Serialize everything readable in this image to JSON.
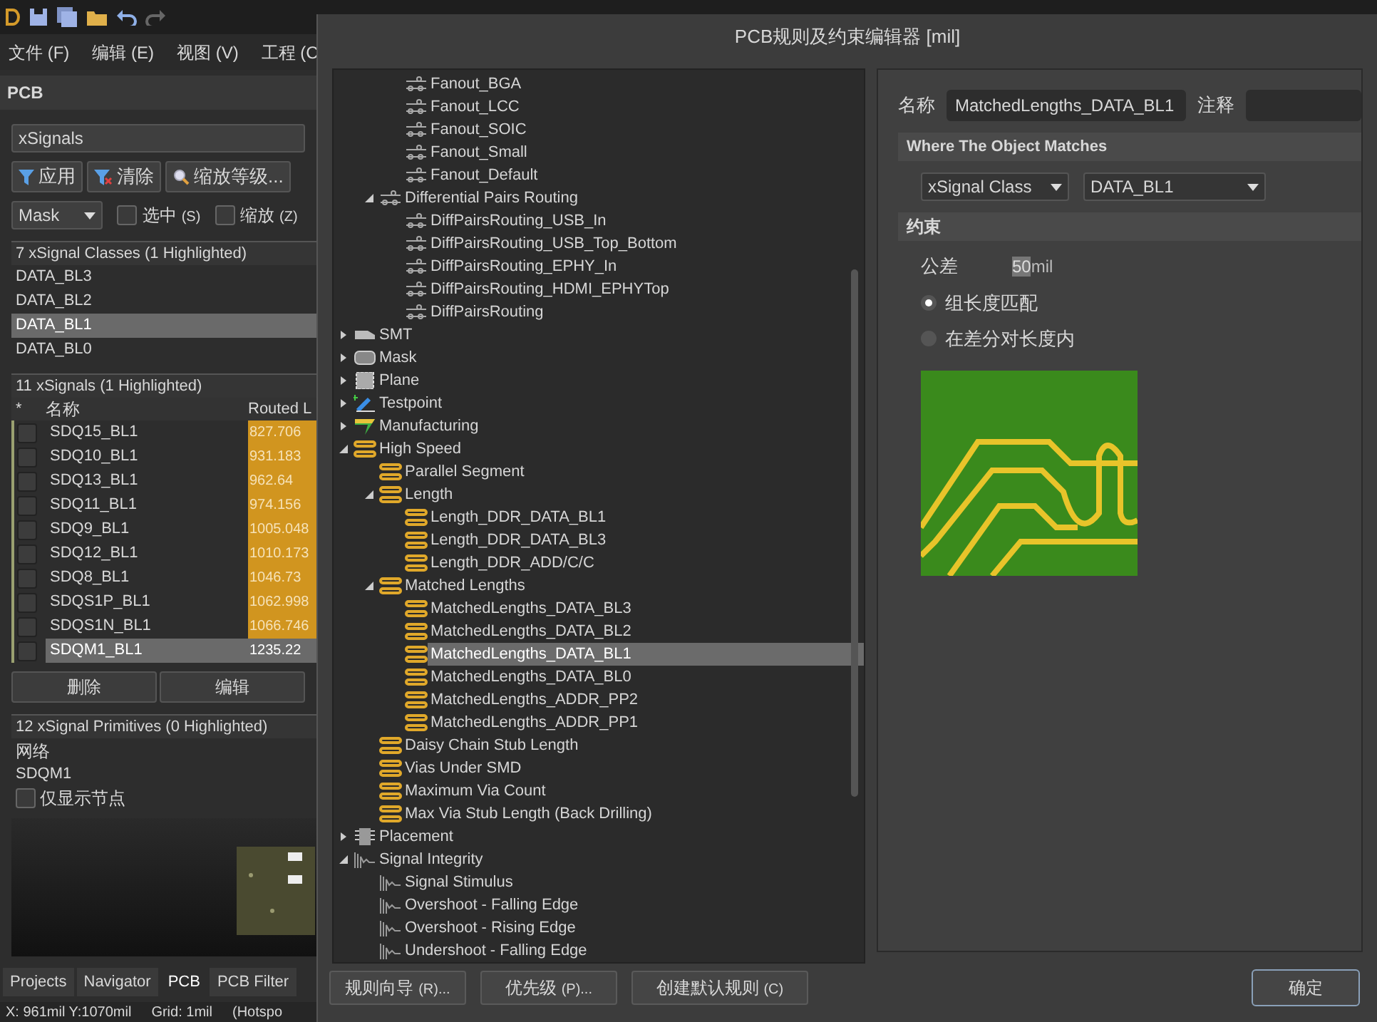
{
  "menu": [
    "文件 (F)",
    "编辑 (E)",
    "视图 (V)",
    "工程 (C"
  ],
  "panel": {
    "title": "PCB",
    "filter_select": "xSignals",
    "filter_buttons": [
      {
        "kind": "filter",
        "label": "应用"
      },
      {
        "kind": "clear",
        "label": "清除"
      },
      {
        "kind": "zoom",
        "label": "缩放等级..."
      }
    ],
    "mask_select": "Mask",
    "options": [
      {
        "label": "选中",
        "hotkey": "(S)",
        "checked": false
      },
      {
        "label": "缩放",
        "hotkey": "(Z)",
        "checked": false
      }
    ],
    "classes": {
      "header": "7 xSignal Classes (1 Highlighted)",
      "rows": [
        {
          "name": "DATA_BL3",
          "selected": false
        },
        {
          "name": "DATA_BL2",
          "selected": false
        },
        {
          "name": "DATA_BL1",
          "selected": true
        },
        {
          "name": "DATA_BL0",
          "selected": false
        }
      ]
    },
    "signals": {
      "header": "11 xSignals (1 Highlighted)",
      "columns": [
        "*",
        "名称",
        "Routed L"
      ],
      "rows": [
        {
          "name": "SDQ15_BL1",
          "routed": "827.706",
          "selected": false
        },
        {
          "name": "SDQ10_BL1",
          "routed": "931.183",
          "selected": false
        },
        {
          "name": "SDQ13_BL1",
          "routed": "962.64",
          "selected": false
        },
        {
          "name": "SDQ11_BL1",
          "routed": "974.156",
          "selected": false
        },
        {
          "name": "SDQ9_BL1",
          "routed": "1005.048",
          "selected": false
        },
        {
          "name": "SDQ12_BL1",
          "routed": "1010.173",
          "selected": false
        },
        {
          "name": "SDQ8_BL1",
          "routed": "1046.73",
          "selected": false
        },
        {
          "name": "SDQS1P_BL1",
          "routed": "1062.998",
          "selected": false
        },
        {
          "name": "SDQS1N_BL1",
          "routed": "1066.746",
          "selected": false
        },
        {
          "name": "SDQM1_BL1",
          "routed": "1235.22",
          "selected": true
        }
      ]
    },
    "actions": [
      "删除",
      "编辑"
    ],
    "primitives": {
      "header": "12 xSignal Primitives (0 Highlighted)",
      "column": "网络",
      "row": "SDQM1"
    },
    "nodes_only": {
      "label": "仅显示节点",
      "checked": false
    },
    "tabs": [
      {
        "label": "Projects",
        "selected": false
      },
      {
        "label": "Navigator",
        "selected": false
      },
      {
        "label": "PCB",
        "selected": true
      },
      {
        "label": "PCB Filter",
        "selected": false
      }
    ],
    "status_bar": [
      "X: 961mil Y:1070mil",
      "Grid: 1mil",
      "(Hotspo"
    ]
  },
  "dialog": {
    "title": "PCB规则及约束编辑器 [mil]",
    "tree": [
      {
        "children": [
          {
            "children": [
              {
                "label": "Fanout_BGA",
                "kind": "routing",
                "selected": false
              },
              {
                "label": "Fanout_LCC",
                "kind": "routing",
                "selected": false
              },
              {
                "label": "Fanout_SOIC",
                "kind": "routing",
                "selected": false
              },
              {
                "label": "Fanout_Small",
                "kind": "routing",
                "selected": false
              },
              {
                "label": "Fanout_Default",
                "kind": "routing",
                "selected": false
              }
            ]
          },
          {
            "label": "Differential Pairs Routing",
            "kind": "routing",
            "selected": false,
            "expanded": true,
            "children": [
              {
                "label": "DiffPairsRouting_USB_In",
                "kind": "routing",
                "selected": false
              },
              {
                "label": "DiffPairsRouting_USB_Top_Bottom",
                "kind": "routing",
                "selected": false
              },
              {
                "label": "DiffPairsRouting_EPHY_In",
                "kind": "routing",
                "selected": false
              },
              {
                "label": "DiffPairsRouting_HDMI_EPHYTop",
                "kind": "routing",
                "selected": false
              },
              {
                "label": "DiffPairsRouting",
                "kind": "routing",
                "selected": false
              }
            ]
          }
        ]
      },
      {
        "label": "SMT",
        "kind": "smt",
        "selected": false,
        "expanded": false
      },
      {
        "label": "Mask",
        "kind": "mask",
        "selected": false,
        "expanded": false
      },
      {
        "label": "Plane",
        "kind": "plane",
        "selected": false,
        "expanded": false
      },
      {
        "label": "Testpoint",
        "kind": "testpoint",
        "selected": false,
        "expanded": false
      },
      {
        "label": "Manufacturing",
        "kind": "manufacturing",
        "selected": false,
        "expanded": false
      },
      {
        "label": "High Speed",
        "kind": "highspeed",
        "selected": false,
        "expanded": true,
        "children": [
          {
            "label": "Parallel Segment",
            "kind": "highspeed",
            "selected": false
          },
          {
            "label": "Length",
            "kind": "highspeed",
            "selected": false,
            "expanded": true,
            "children": [
              {
                "label": "Length_DDR_DATA_BL1",
                "kind": "highspeed",
                "selected": false
              },
              {
                "label": "Length_DDR_DATA_BL3",
                "kind": "highspeed",
                "selected": false
              },
              {
                "label": "Length_DDR_ADD/C/C",
                "kind": "highspeed",
                "selected": false
              }
            ]
          },
          {
            "label": "Matched Lengths",
            "kind": "highspeed",
            "selected": false,
            "expanded": true,
            "children": [
              {
                "label": "MatchedLengths_DATA_BL3",
                "kind": "highspeed",
                "selected": false
              },
              {
                "label": "MatchedLengths_DATA_BL2",
                "kind": "highspeed",
                "selected": false
              },
              {
                "label": "MatchedLengths_DATA_BL1",
                "kind": "highspeed",
                "selected": true
              },
              {
                "label": "MatchedLengths_DATA_BL0",
                "kind": "highspeed",
                "selected": false
              },
              {
                "label": "MatchedLengths_ADDR_PP2",
                "kind": "highspeed",
                "selected": false
              },
              {
                "label": "MatchedLengths_ADDR_PP1",
                "kind": "highspeed",
                "selected": false
              }
            ]
          },
          {
            "label": "Daisy Chain Stub Length",
            "kind": "highspeed",
            "selected": false
          },
          {
            "label": "Vias Under SMD",
            "kind": "highspeed",
            "selected": false
          },
          {
            "label": "Maximum Via Count",
            "kind": "highspeed",
            "selected": false
          },
          {
            "label": "Max Via Stub Length (Back Drilling)",
            "kind": "highspeed",
            "selected": false
          }
        ]
      },
      {
        "label": "Placement",
        "kind": "placement",
        "selected": false,
        "expanded": false
      },
      {
        "label": "Signal Integrity",
        "kind": "signal",
        "selected": false,
        "expanded": true,
        "children": [
          {
            "label": "Signal Stimulus",
            "kind": "signal",
            "selected": false
          },
          {
            "label": "Overshoot - Falling Edge",
            "kind": "signal",
            "selected": false
          },
          {
            "label": "Overshoot - Rising Edge",
            "kind": "signal",
            "selected": false
          },
          {
            "label": "Undershoot - Falling Edge",
            "kind": "signal",
            "selected": false
          }
        ]
      }
    ],
    "name_label": "名称",
    "name_value": "MatchedLengths_DATA_BL1",
    "comment_label": "注释",
    "match_header": "Where The Object Matches",
    "match_type": "xSignal Class",
    "match_value": "DATA_BL1",
    "constraints_header": "约束",
    "tolerance_label": "公差",
    "tolerance_value": "50",
    "tolerance_unit": "mil",
    "modes": [
      {
        "label": "组长度匹配",
        "selected": true
      },
      {
        "label": "在差分对长度内",
        "selected": false
      }
    ],
    "buttons": [
      {
        "label": "规则向导",
        "hotkey": "(R)..."
      },
      {
        "label": "优先级",
        "hotkey": "(P)..."
      },
      {
        "label": "创建默认规则",
        "hotkey": "(C)"
      }
    ],
    "ok": "确定"
  }
}
